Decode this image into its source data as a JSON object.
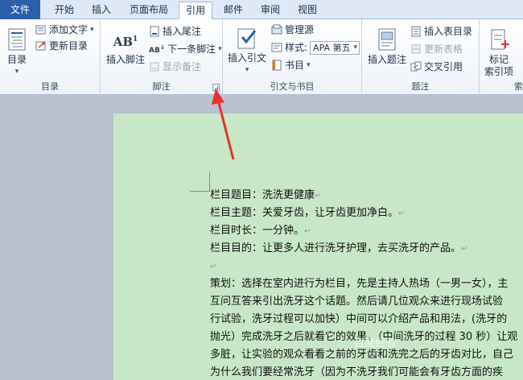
{
  "tabs": [
    {
      "label": "文件"
    },
    {
      "label": "开始"
    },
    {
      "label": "插入"
    },
    {
      "label": "页面布局"
    },
    {
      "label": "引用"
    },
    {
      "label": "邮件"
    },
    {
      "label": "审阅"
    },
    {
      "label": "视图"
    }
  ],
  "ribbon": {
    "toc": {
      "label": "目录",
      "main_label": "目录",
      "add_text": "添加文字",
      "update_toc": "更新目录"
    },
    "footnotes": {
      "label": "脚注",
      "insert_footnote": "插入脚注",
      "insert_endnote": "插入尾注",
      "next_footnote": "下一条脚注",
      "show_notes": "显示备注",
      "ab_glyph": "AB",
      "ab_sup": "1"
    },
    "citations": {
      "label": "引文与书目",
      "insert_citation": "插入引文",
      "manage_sources": "管理源",
      "style_label": "样式:",
      "style_value": "APA 第五",
      "bibliography": "书目"
    },
    "captions": {
      "label": "题注",
      "insert_caption": "插入题注",
      "insert_table_of_figures": "插入表目录",
      "update_table": "更新表格",
      "cross_reference": "交叉引用"
    },
    "index": {
      "label": "索",
      "mark_entry_line1": "标记",
      "mark_entry_line2": "索引项"
    }
  },
  "document": {
    "lines": [
      "栏目题目：洗洗更健康",
      "栏目主题：关爱牙齿，让牙齿更加净白。",
      "栏目时长：一分钟。",
      "栏目目的：让更多人进行洗牙护理，去买洗牙的产品。",
      "",
      "策划：选择在室内进行为栏目，先是主持人热场（一男一女），主",
      "互问互答来引出洗牙这个话题。然后请几位观众来进行现场试验",
      "行试验，洗牙过程可以加快）中间可以介绍产品和用法，(洗牙的",
      "抛光）完成洗牙之后就看它的效果，（中间洗牙的过程 30 秒）让观",
      "多脏，让实验的观众看看之前的牙齿和洗完之后的牙齿对比，自己",
      "为什么我们要经常洗牙（因为不洗牙我们可能会有牙齿方面的疾"
    ]
  },
  "watermark": "百度经验"
}
